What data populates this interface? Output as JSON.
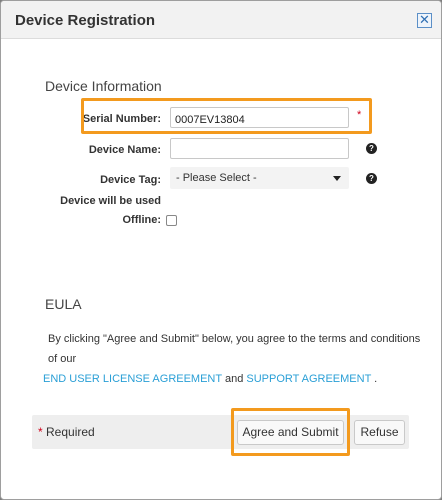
{
  "dialog": {
    "title": "Device Registration",
    "close_label": "✕"
  },
  "device_info": {
    "heading": "Device Information",
    "serial_number": {
      "label": "Serial Number:",
      "value": "0007EV13804",
      "required_mark": "*"
    },
    "device_name": {
      "label": "Device Name:",
      "value": "",
      "help": "?"
    },
    "device_tag": {
      "label": "Device Tag:",
      "selected": "- Please Select -",
      "help": "?"
    },
    "offline": {
      "label_line1": "Device will be used",
      "label_line2": "Offline:",
      "checked": false
    }
  },
  "eula": {
    "heading": "EULA",
    "text_before": "By clicking \"Agree and Submit\" below, you agree to the terms and conditions of our",
    "link1": "END USER LICENSE AGREEMENT",
    "and": "and",
    "link2": "SUPPORT AGREEMENT",
    "end": "."
  },
  "footer": {
    "required_star": "*",
    "required_label": "Required",
    "submit_label": "Agree and Submit",
    "refuse_label": "Refuse"
  },
  "colors": {
    "highlight": "#f39a1e",
    "link": "#2a9fd6",
    "required": "#d0021b"
  }
}
